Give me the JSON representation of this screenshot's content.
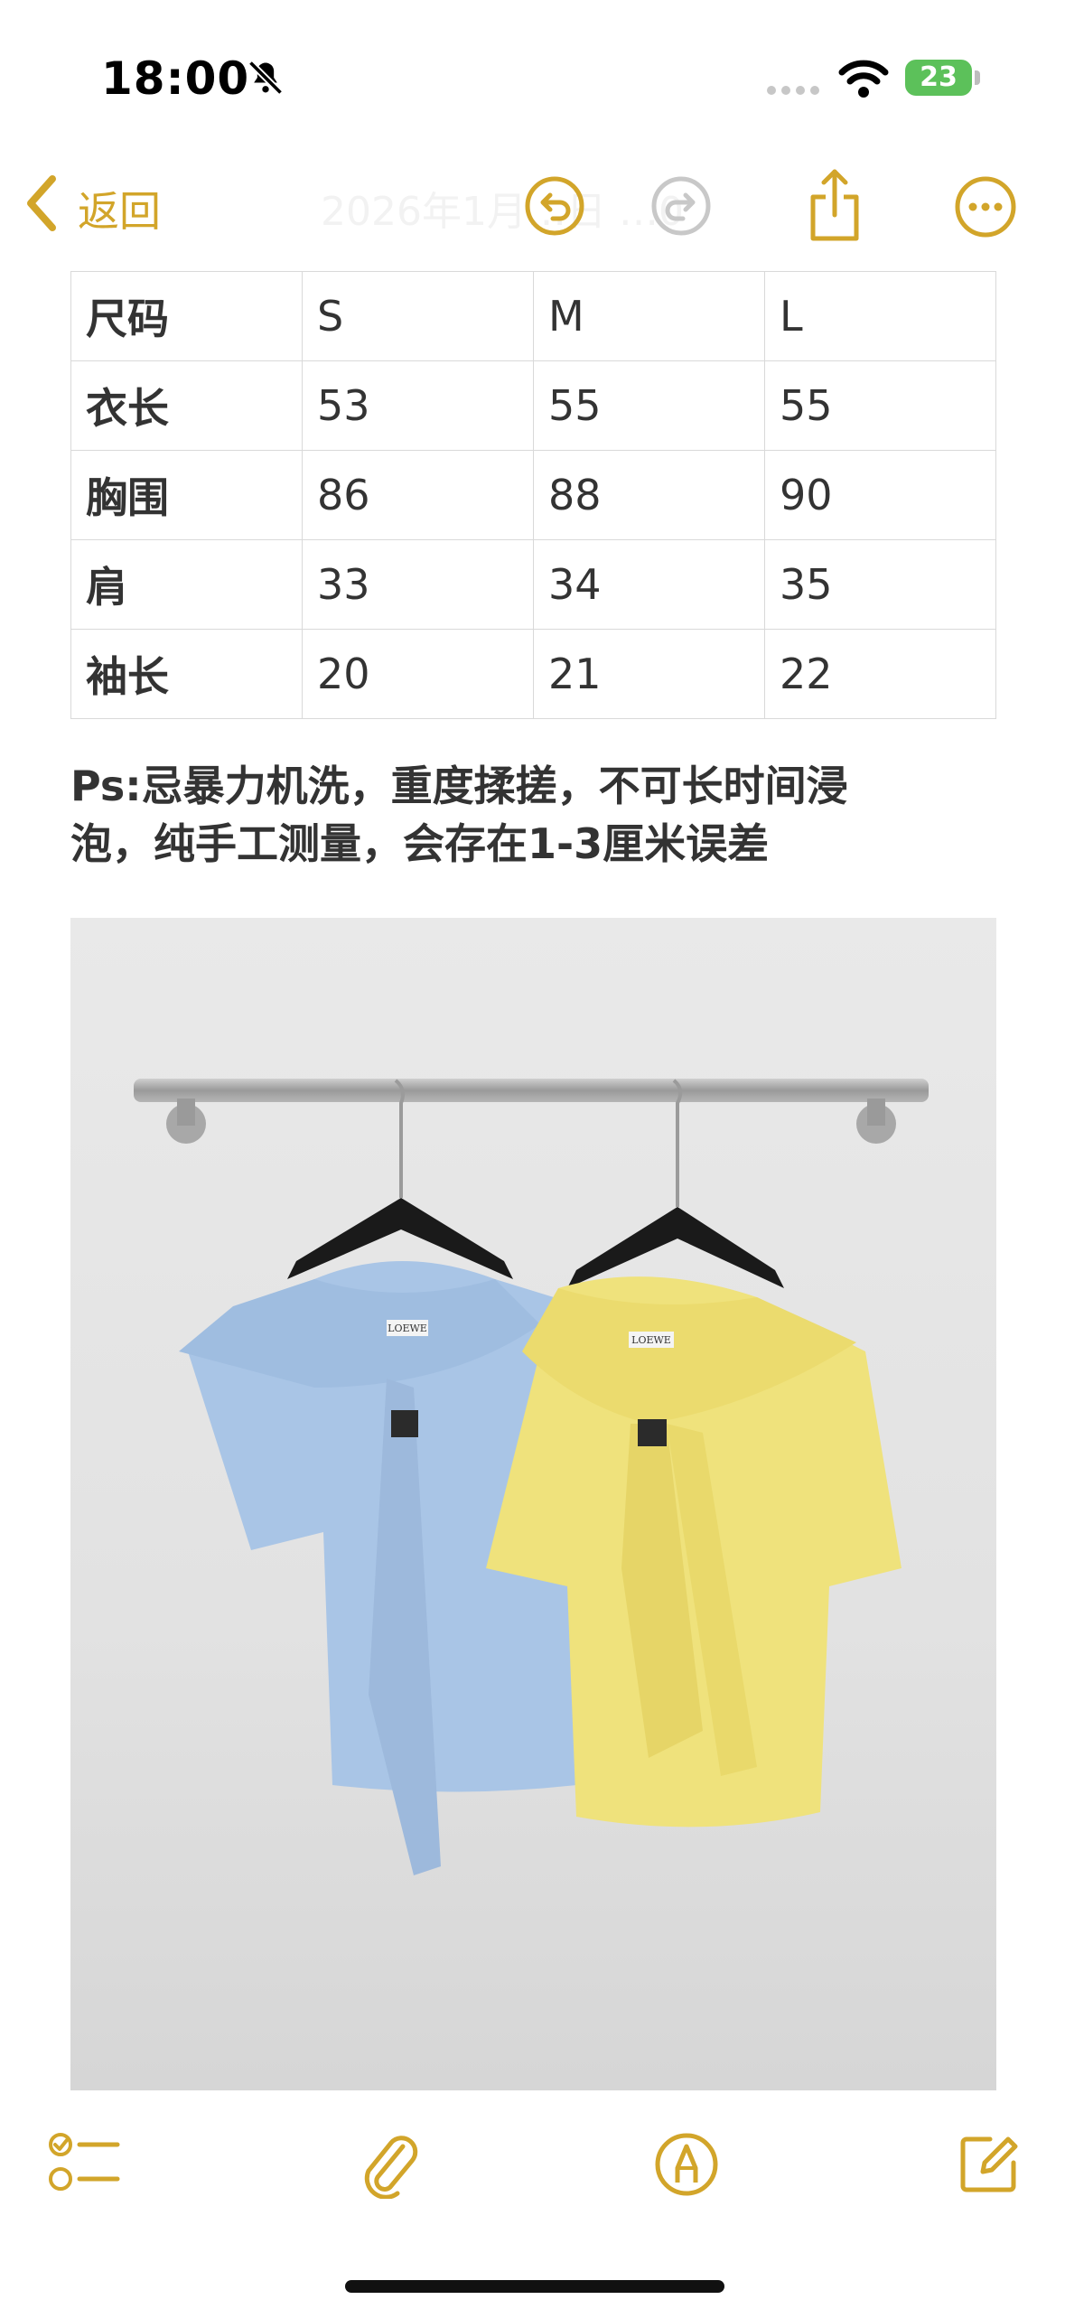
{
  "status_bar": {
    "time": "18:00",
    "battery": "23",
    "icons": [
      "bell-slash-icon",
      "cellular-icon",
      "wifi-icon",
      "battery-icon"
    ]
  },
  "nav": {
    "back_label": "返回",
    "faded_title": "2026年1月…日 …0",
    "icons": [
      "chevron-left-icon",
      "undo-icon",
      "redo-icon",
      "share-icon",
      "more-icon"
    ]
  },
  "size_table": {
    "header": [
      "尺码",
      "S",
      "M",
      "L"
    ],
    "rows": [
      [
        "衣长",
        "53",
        "55",
        "55"
      ],
      [
        "胸围",
        "86",
        "88",
        "90"
      ],
      [
        "肩",
        "33",
        "34",
        "35"
      ],
      [
        "袖长",
        "20",
        "21",
        "22"
      ]
    ]
  },
  "note": {
    "line1": "Ps:忌暴力机洗，重度揉搓，不可长时间浸",
    "line2": "泡，纯手工测量，会存在1-3厘米误差"
  },
  "photo": {
    "label_blue": "LOEWE",
    "label_yellow": "LOEWE"
  },
  "toolbar": {
    "icons": [
      "checklist-icon",
      "paperclip-icon",
      "markup-icon",
      "compose-icon"
    ]
  },
  "colors": {
    "accent": "#d2a52a",
    "battery": "#5cc15a",
    "table_border": "#d9d9d9",
    "text": "#333333",
    "shirt_blue": "#a9c5e6",
    "shirt_yellow": "#efe27c"
  }
}
